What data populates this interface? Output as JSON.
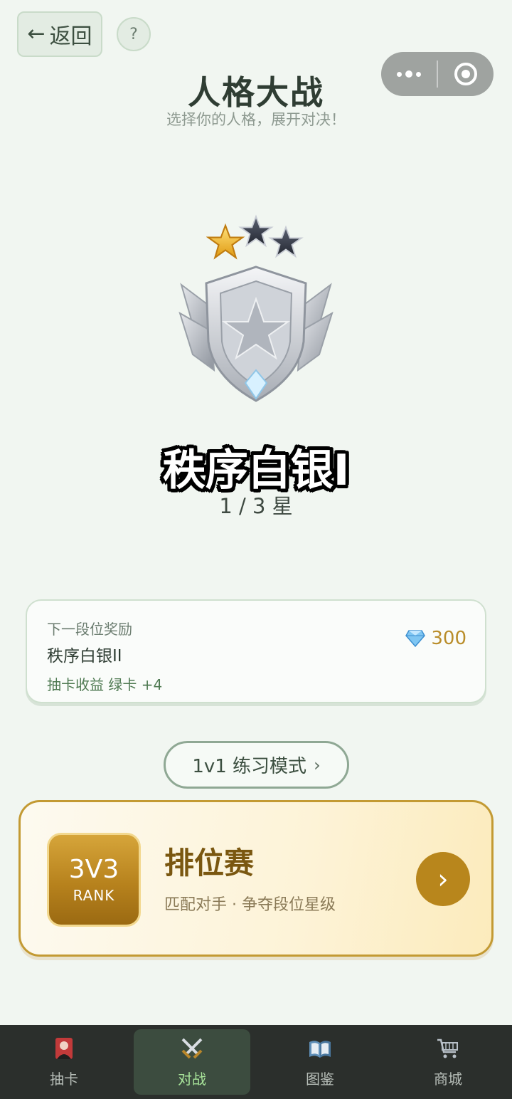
{
  "header": {
    "back_arrow": "←",
    "back_label": "返回",
    "help_label": "?",
    "title": "人格大战",
    "subtitle": "选择你的人格，展开对决！"
  },
  "rank": {
    "stars_filled": 1,
    "stars_total": 3,
    "name": "秩序白银I",
    "progress_text": "1 / 3 星"
  },
  "reward": {
    "label": "下一段位奖励",
    "rank": "秩序白银II",
    "bonus": "抽卡收益  绿卡 +4",
    "diamonds": "300"
  },
  "practice": {
    "label": "1v1  练习模式",
    "chevron": "›"
  },
  "ranked": {
    "badge_main": "3V3",
    "badge_sub": "RANK",
    "title": "排位赛",
    "description": "匹配对手  ·  争夺段位星级",
    "arrow": "›"
  },
  "tabbar": {
    "items": [
      {
        "label": "抽卡",
        "icon": "card-icon",
        "active": false
      },
      {
        "label": "对战",
        "icon": "swords-icon",
        "active": true
      },
      {
        "label": "图鉴",
        "icon": "book-icon",
        "active": false
      },
      {
        "label": "商城",
        "icon": "cart-icon",
        "active": false
      }
    ]
  },
  "colors": {
    "background": "#f1f6f1",
    "gold": "#b8861c",
    "active_tab": "#a8e49a"
  }
}
